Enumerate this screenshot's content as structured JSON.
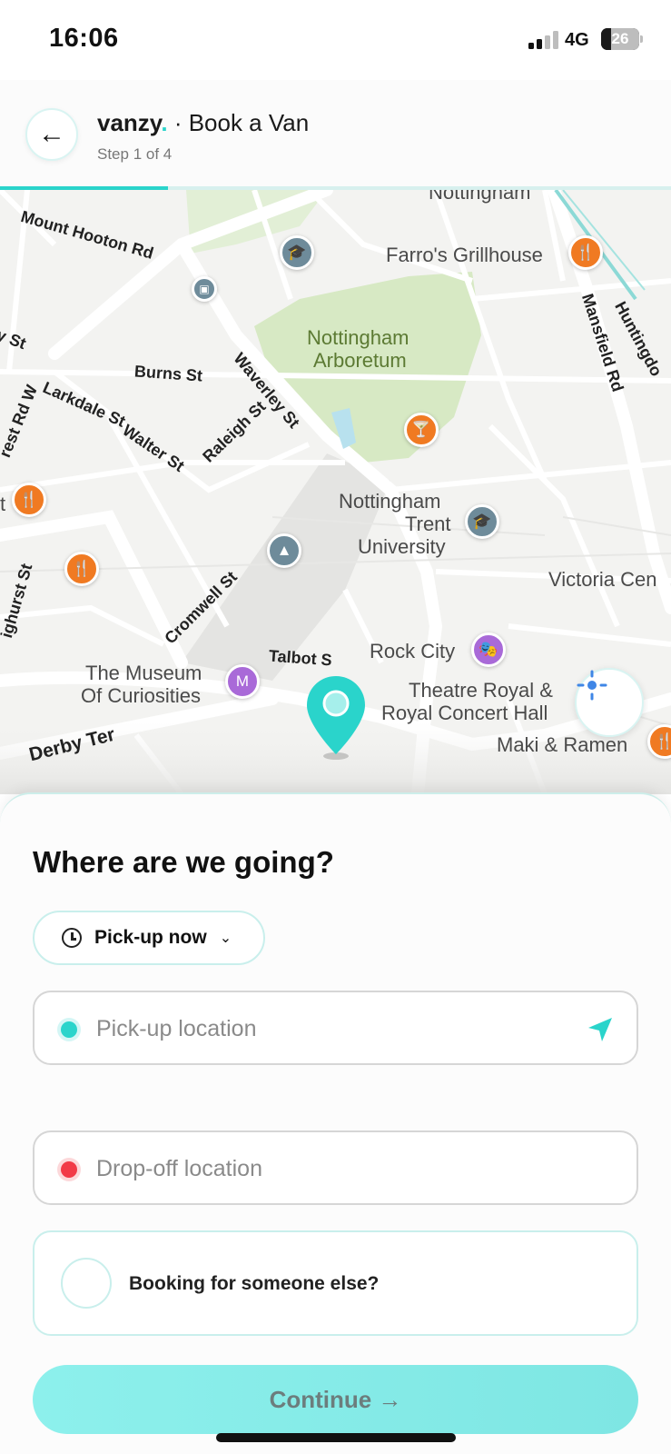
{
  "status_bar": {
    "time": "16:06",
    "network": "4G",
    "battery": "26",
    "battery_level": 0.26
  },
  "header": {
    "back_icon": "←",
    "brand": "vanzy",
    "brand_dot": ".",
    "title": "· Book a Van",
    "step": "Step 1 of 4",
    "progress": 0.25
  },
  "map": {
    "streets": {
      "mount_hooton": "Mount Hooton Rd",
      "burns": "Burns St",
      "larkdale": "Larkdale St",
      "walter": "Walter St",
      "raleigh": "Raleigh St",
      "waverley": "Waverley St",
      "cromwell": "Cromwell St",
      "talbot": "Talbot S",
      "derby": "Derby Ter",
      "mansfield": "Mansfield Rd",
      "huntingdon": "Huntingdo",
      "forest_rd_w": "rest Rd W",
      "y_st": "y St",
      "ighurst": "ighurst St",
      "nottingham_top": "Nottingham"
    },
    "places": {
      "farros": "Farro's Grillhouse",
      "arboretum_1": "Nottingham",
      "arboretum_2": "Arboretum",
      "ntu_1": "Nottingham",
      "ntu_2": "Trent",
      "ntu_3": "University",
      "victoria": "Victoria Cen",
      "rock_city": "Rock City",
      "museum_1": "The Museum",
      "museum_2": "Of Curiosities",
      "theatre_1": "Theatre Royal &",
      "theatre_2": "Royal Concert Hall",
      "maki": "Maki & Ramen",
      "t_edge": "t"
    },
    "icons": {
      "food": "fork-knife-icon",
      "edu": "graduation-cap-icon",
      "bar": "cocktail-icon",
      "fun": "theatre-masks-icon",
      "museum": "museum-icon",
      "park": "tree-icon",
      "rail": "tram-icon",
      "locate": "crosshair-icon",
      "pin": "map-pin-icon"
    },
    "poi_glyphs": {
      "food": "🍴",
      "edu": "🎓",
      "bar": "🍸",
      "fun": "🎭",
      "museum": "M",
      "park": "▲",
      "rail": "▣"
    }
  },
  "sheet": {
    "title": "Where are we going?",
    "pickup_time": "Pick-up now",
    "chevron": "⌄",
    "pickup_placeholder": "Pick-up location",
    "dropoff_placeholder": "Drop-off location",
    "someone_else": "Booking for someone else?",
    "continue": "Continue →"
  },
  "colors": {
    "accent": "#2ad4cb",
    "dropoff": "#f23a47",
    "food_poi": "#f07a22",
    "fun_poi": "#a96ad8",
    "edu_poi": "#6e8b9a"
  }
}
